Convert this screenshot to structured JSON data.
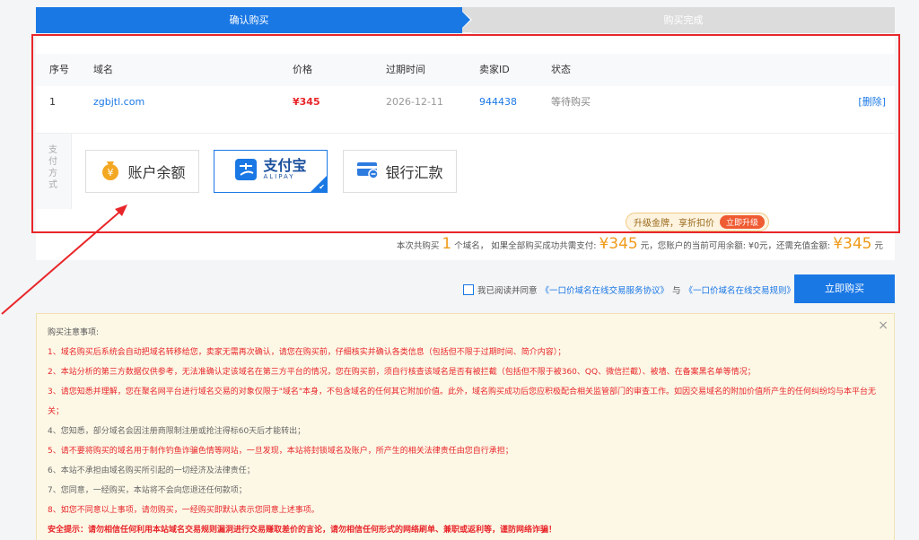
{
  "steps": {
    "current": "确认购买",
    "next": "购买完成"
  },
  "table": {
    "headers": [
      "序号",
      "域名",
      "价格",
      "过期时间",
      "卖家ID",
      "状态"
    ],
    "row": {
      "index": "1",
      "domain": "zgbjtl.com",
      "price": "¥345",
      "expire": "2026-12-11",
      "seller": "944438",
      "status": "等待购买",
      "delete": "[删除]"
    }
  },
  "payment": {
    "label": "支付方式",
    "options": [
      {
        "name": "账户余额",
        "icon": "wallet-icon",
        "selected": false
      },
      {
        "name": "支付宝",
        "sub": "ALIPAY",
        "icon": "alipay-icon",
        "selected": true
      },
      {
        "name": "银行汇款",
        "icon": "bank-card-icon",
        "selected": false
      }
    ]
  },
  "upgrade": {
    "text": "升级金牌，享折扣价",
    "button": "立即升级"
  },
  "summary": {
    "prefix": "本次共购买",
    "count": "1",
    "mid1": "个域名， 如果全部购买成功共需支付:",
    "total": "¥345",
    "mid2": "元，您账户的当前可用余额: ¥0元，还需充值金额:",
    "recharge": "¥345",
    "suffix": "元"
  },
  "agree": {
    "prefix": "我已阅读并同意",
    "link1": "《一口价域名在线交易服务协议》",
    "and": "与",
    "link2": "《一口价域名在线交易规则》"
  },
  "buy_button": "立即购买",
  "notice": {
    "title": "购买注意事项:",
    "items": [
      "1、域名购买后系统会自动把域名转移给您，卖家无需再次确认，请您在购买前，仔细核实并确认各类信息（包括但不限于过期时间、简介内容）；",
      "2、本站分析的第三方数据仅供参考，无法准确认定该域名在第三方平台的情况，您在购买前，须自行核查该域名是否有被拦截（包括但不限于被360、QQ、微信拦截）、被墙、在备案黑名单等情况；",
      "3、请您知悉并理解，您在聚名网平台进行域名交易的对象仅限于\"域名\"本身，不包含域名的任何其它附加价值。此外，域名购买成功后您应积极配合相关监管部门的审查工作。如因交易域名的附加价值所产生的任何纠纷均与本平台无关；",
      "4、您知悉，部分域名会因注册商限制注册或抢注得标60天后才能转出；",
      "5、请不要将购买的域名用于制作钓鱼诈骗色情等网站，一旦发现，本站将封锁域名及账户，所产生的相关法律责任由您自行承担；",
      "6、本站不承担由域名购买所引起的一切经济及法律责任；",
      "7、您同意，一经购买，本站将不会向您退还任何款项；",
      "8、如您不同意以上事项，请勿购买，一经购买即默认表示您同意上述事项。"
    ],
    "warning": "安全提示：请勿相信任何利用本站域名交易规则漏洞进行交易赚取差价的言论，请勿相信任何形式的网络刷单、兼职或返利等，谨防网络诈骗！",
    "close": "×"
  }
}
